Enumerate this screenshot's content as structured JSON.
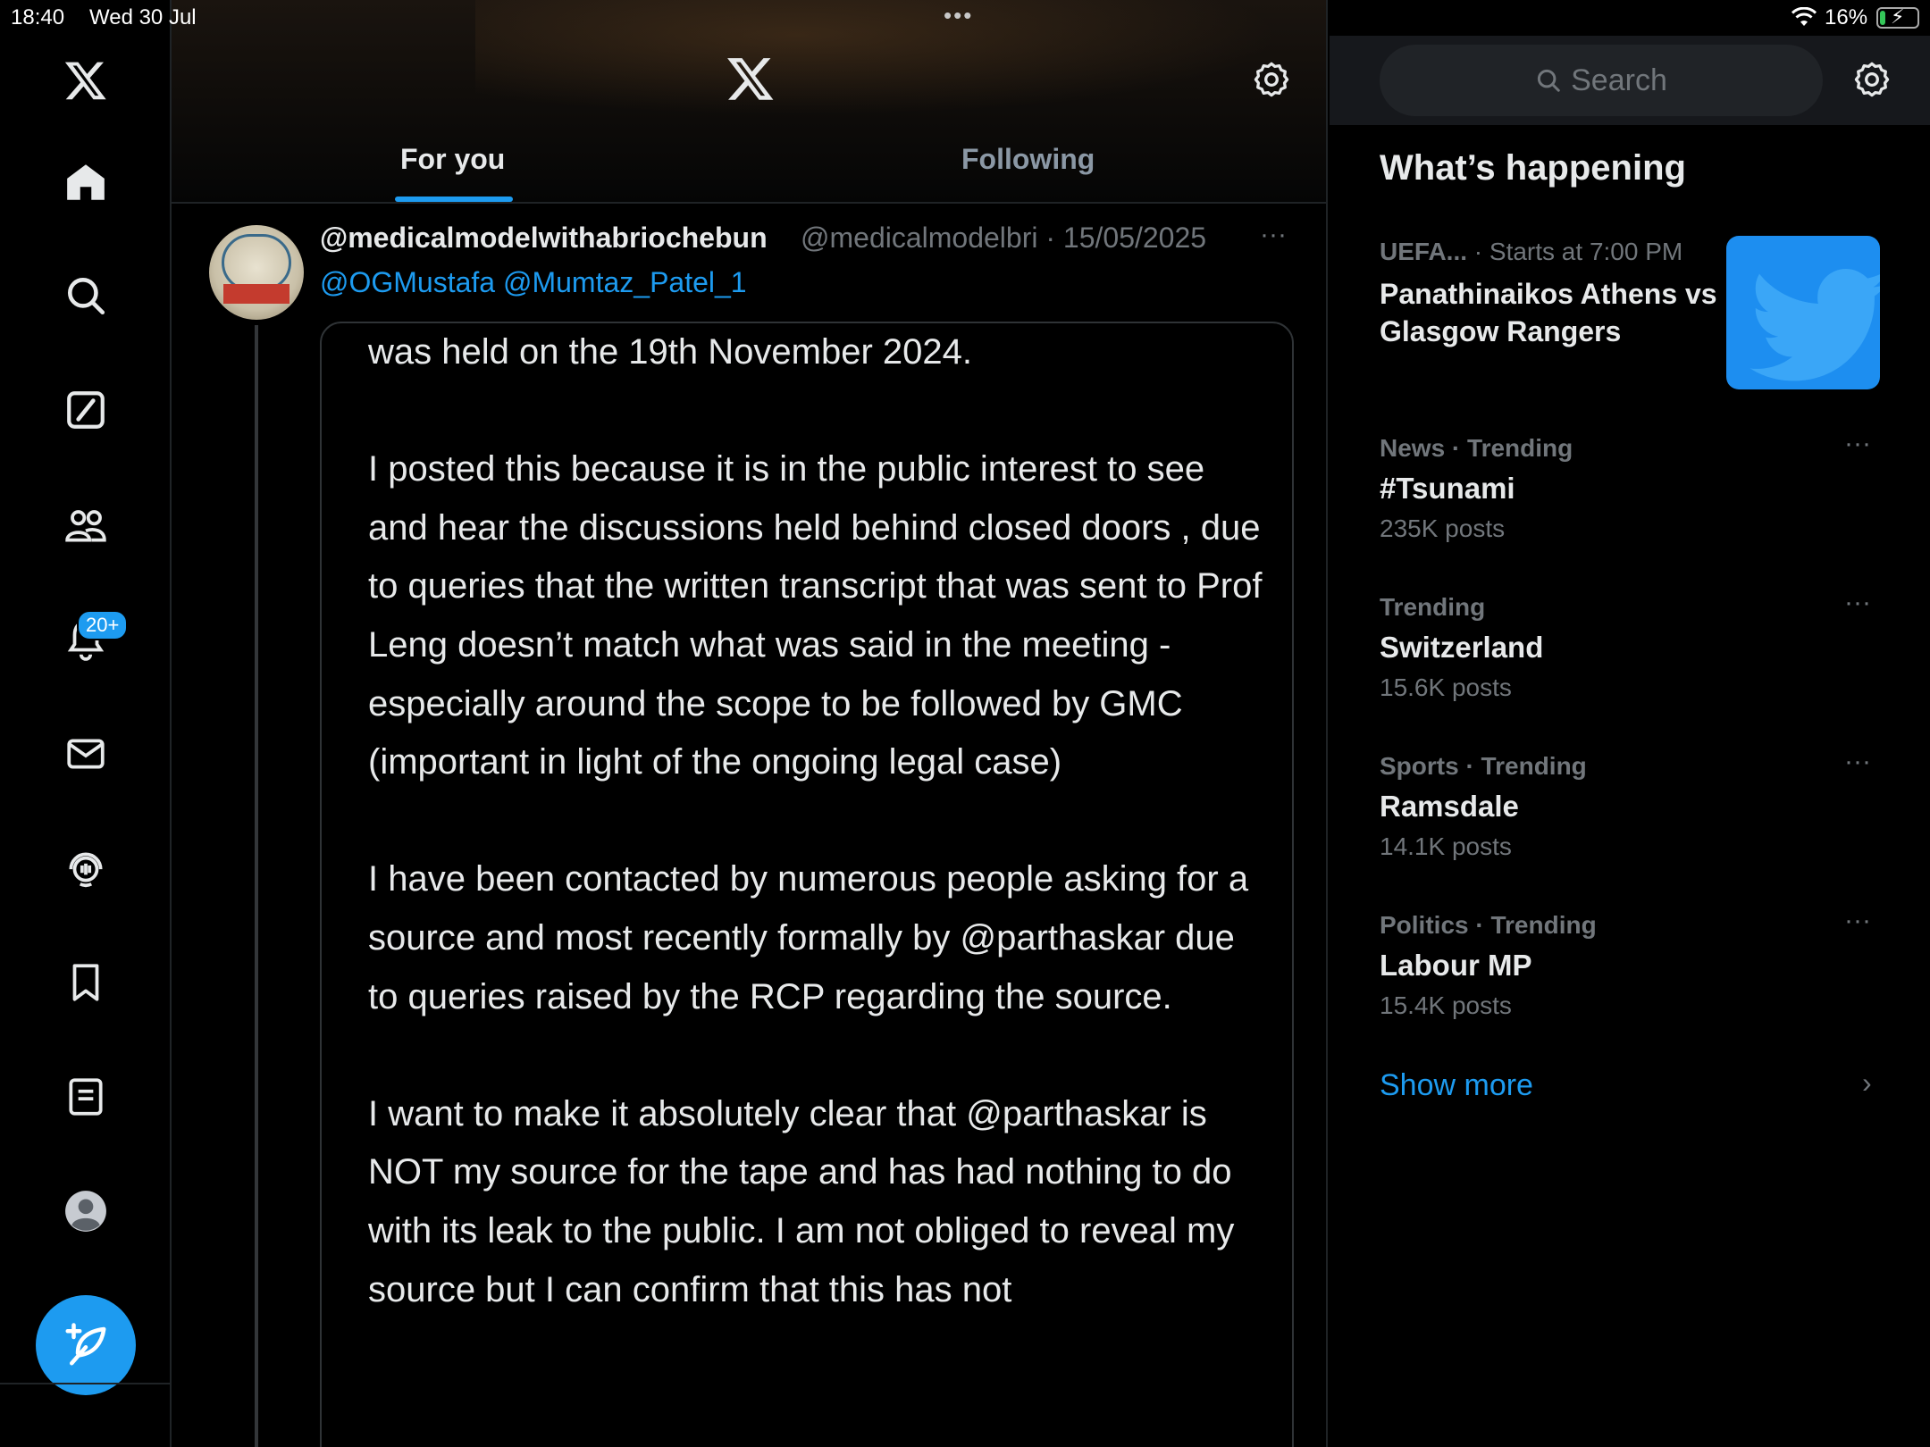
{
  "status_bar": {
    "time": "18:40",
    "date": "Wed 30 Jul",
    "multitask_dots": "•••",
    "battery_percent": "16%",
    "battery_level": 0.16,
    "charging": true
  },
  "nav": {
    "notifications_badge": "20+",
    "items": [
      "x-logo",
      "home",
      "search",
      "grok",
      "communities",
      "notifications",
      "messages",
      "spaces",
      "bookmarks",
      "lists",
      "profile"
    ]
  },
  "header": {
    "tabs": [
      {
        "label": "For you",
        "active": true
      },
      {
        "label": "Following",
        "active": false
      }
    ]
  },
  "tweet": {
    "display_name": "@medicalmodelwithabriochebun",
    "handle_date": "@medicalmodelbri · 15/05/2025",
    "more": "···",
    "mentions": "@OGMustafa @Mumtaz_Patel_1",
    "note_text": "was held on the 19th November 2024.\n\nI posted this because it is in the public interest to see and hear the discussions held behind closed doors , due to queries that the written transcript that was sent to Prof Leng doesn’t match what was said in the meeting - especially around the scope to be followed by GMC (important in light of the ongoing legal case)\n\nI have been contacted by numerous people  asking for a source and most recently formally by @parthaskar due to queries raised by the RCP regarding the source.\n\nI want to make it absolutely clear that @parthaskar is NOT my source for the tape and has had nothing to do with its leak to the public. I am not obliged to reveal my source but I can confirm that this has not"
  },
  "sidebar": {
    "search_placeholder": "Search",
    "section_title": "What’s happening",
    "event": {
      "category": "UEFA...",
      "time": "· Starts at 7:00 PM",
      "title": "Panathinaikos Athens vs Glasgow Rangers"
    },
    "trends": [
      {
        "category": "News · Trending",
        "title": "#Tsunami",
        "count": "235K posts"
      },
      {
        "category": "Trending",
        "title": "Switzerland",
        "count": "15.6K posts"
      },
      {
        "category": "Sports · Trending",
        "title": "Ramsdale",
        "count": "14.1K posts"
      },
      {
        "category": "Politics · Trending",
        "title": "Labour MP",
        "count": "15.4K posts"
      }
    ],
    "trend_more": "···",
    "show_more": "Show more",
    "show_more_chevron": "›"
  },
  "colors": {
    "accent": "#1d9bf0",
    "background": "#000000",
    "text_primary": "#e7e9ea",
    "text_secondary": "#71767b"
  }
}
